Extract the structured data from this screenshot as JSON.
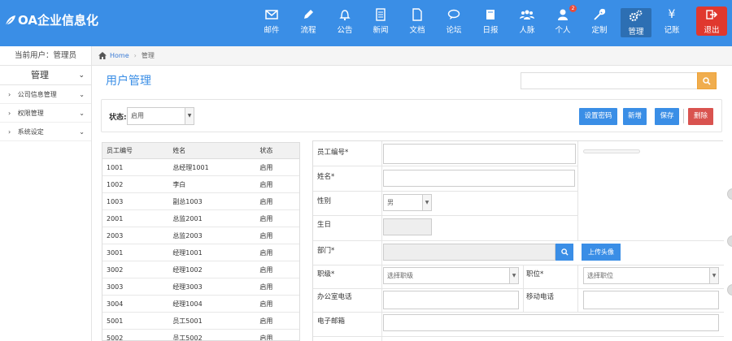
{
  "app": {
    "logo_text": "OA企业信息化"
  },
  "nav": [
    {
      "id": "mail",
      "label": "邮件",
      "icon": "mail-icon"
    },
    {
      "id": "flow",
      "label": "流程",
      "icon": "pencil-icon"
    },
    {
      "id": "notice",
      "label": "公告",
      "icon": "bell-icon"
    },
    {
      "id": "news",
      "label": "新闻",
      "icon": "document-icon"
    },
    {
      "id": "docs",
      "label": "文档",
      "icon": "file-icon"
    },
    {
      "id": "forum",
      "label": "论坛",
      "icon": "comment-icon"
    },
    {
      "id": "daily",
      "label": "日报",
      "icon": "book-icon"
    },
    {
      "id": "people",
      "label": "人脉",
      "icon": "group-icon"
    },
    {
      "id": "personal",
      "label": "个人",
      "icon": "user-icon",
      "badge": "2"
    },
    {
      "id": "custom",
      "label": "定制",
      "icon": "wrench-icon"
    },
    {
      "id": "manage",
      "label": "管理",
      "icon": "gears-icon"
    },
    {
      "id": "accounts",
      "label": "记账",
      "icon": "yen-icon"
    },
    {
      "id": "exit",
      "label": "退出",
      "icon": "exit-icon"
    }
  ],
  "sidebar": {
    "current_user": "当前用户：管理员",
    "section_title": "管理",
    "items": [
      {
        "label": "公司信息管理"
      },
      {
        "label": "权限管理"
      },
      {
        "label": "系统设定"
      }
    ]
  },
  "breadcrumb": {
    "home": "Home",
    "current": "管理"
  },
  "page": {
    "title": "用户管理",
    "search_placeholder": ""
  },
  "toolbar": {
    "status_label": "状态:",
    "status_value": "启用",
    "buttons": {
      "reset_pwd": "设置密码",
      "add": "新增",
      "save": "保存",
      "delete": "删除"
    }
  },
  "table": {
    "headers": [
      "员工编号",
      "姓名",
      "状态"
    ],
    "rows": [
      [
        "1001",
        "总经理1001",
        "启用"
      ],
      [
        "1002",
        "李白",
        "启用"
      ],
      [
        "1003",
        "副总1003",
        "启用"
      ],
      [
        "2001",
        "总监2001",
        "启用"
      ],
      [
        "2003",
        "总监2003",
        "启用"
      ],
      [
        "3001",
        "经理1001",
        "启用"
      ],
      [
        "3002",
        "经理1002",
        "启用"
      ],
      [
        "3003",
        "经理3003",
        "启用"
      ],
      [
        "3004",
        "经理1004",
        "启用"
      ],
      [
        "5001",
        "员工5001",
        "启用"
      ],
      [
        "5002",
        "员工5002",
        "启用"
      ]
    ]
  },
  "form": {
    "emp_no_label": "员工编号*",
    "name_label": "姓名*",
    "gender_label": "性别",
    "gender_value": "男",
    "birthday_label": "生日",
    "dept_label": "部门*",
    "upload_label": "上传头像",
    "rank_label": "职级*",
    "rank_placeholder": "选择职级",
    "position_label": "职位*",
    "position_placeholder": "选择职位",
    "office_phone_label": "办公室电话",
    "mobile_label": "移动电话",
    "email_label": "电子邮箱"
  },
  "colors": {
    "primary": "#3a8ee6",
    "danger": "#d9534f",
    "search": "#f0ad4e",
    "exit": "#e0382e"
  }
}
